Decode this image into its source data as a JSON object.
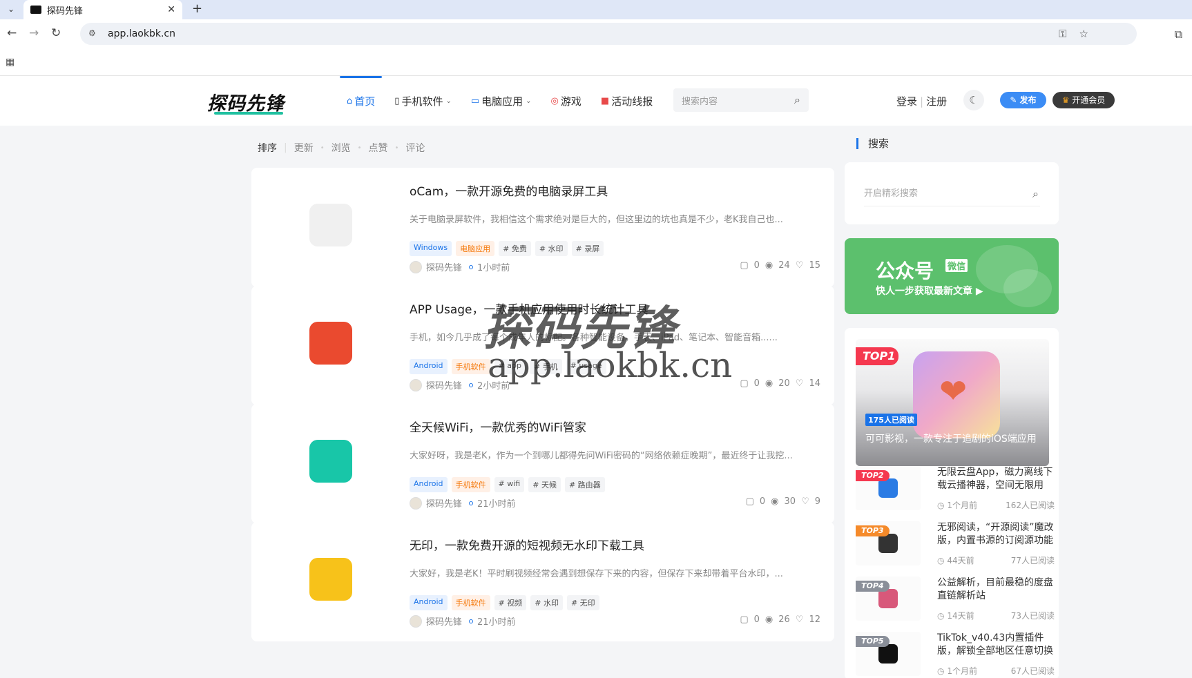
{
  "browser": {
    "tab_title": "探码先锋",
    "url": "app.laokbk.cn"
  },
  "header": {
    "logo": "探码先锋",
    "nav": [
      {
        "label": "首页",
        "icon": "home-icon",
        "active": true
      },
      {
        "label": "手机软件",
        "icon": "phone-icon",
        "dropdown": true
      },
      {
        "label": "电脑应用",
        "icon": "computer-icon",
        "dropdown": true
      },
      {
        "label": "游戏",
        "icon": "game-icon"
      },
      {
        "label": "活动线报",
        "icon": "flag-icon"
      }
    ],
    "search_placeholder": "搜索内容",
    "login": "登录",
    "register": "注册",
    "publish": "发布",
    "vip": "开通会员"
  },
  "sort": {
    "items": [
      "排序",
      "更新",
      "浏览",
      "点赞",
      "评论"
    ]
  },
  "posts": [
    {
      "title": "oCam，一款开源免费的电脑录屏工具",
      "excerpt": "关于电脑录屏软件，我相信这个需求绝对是巨大的，但这里边的坑也真是不少，老K我自己也...",
      "tags": [
        {
          "t": "Windows",
          "c": "blue"
        },
        {
          "t": "电脑应用",
          "c": "orange"
        },
        {
          "t": "# 免费",
          "c": ""
        },
        {
          "t": "# 水印",
          "c": ""
        },
        {
          "t": "# 录屏",
          "c": ""
        }
      ],
      "author": "探码先锋",
      "time": "1小时前",
      "comments": "0",
      "views": "24",
      "likes": "15",
      "icon_color": "#f0f0f0"
    },
    {
      "title": "APP Usage，一款手机应用使用时长统计工具",
      "excerpt": "手机，如今几乎成了每个成年人的标配。各种智能设备，手表、iPad、笔记本、智能音箱......",
      "tags": [
        {
          "t": "Android",
          "c": "blue"
        },
        {
          "t": "手机软件",
          "c": "orange"
        },
        {
          "t": "# app",
          "c": ""
        },
        {
          "t": "# 手机",
          "c": ""
        },
        {
          "t": "# usage",
          "c": ""
        }
      ],
      "author": "探码先锋",
      "time": "2小时前",
      "comments": "0",
      "views": "20",
      "likes": "14",
      "icon_color": "#ea4a2f"
    },
    {
      "title": "全天候WiFi，一款优秀的WiFi管家",
      "excerpt": "大家好呀，我是老K，作为一个到哪儿都得先问WiFi密码的“网络依赖症晚期”，最近终于让我挖...",
      "tags": [
        {
          "t": "Android",
          "c": "blue"
        },
        {
          "t": "手机软件",
          "c": "orange"
        },
        {
          "t": "# wifi",
          "c": ""
        },
        {
          "t": "# 天候",
          "c": ""
        },
        {
          "t": "# 路由器",
          "c": ""
        }
      ],
      "author": "探码先锋",
      "time": "21小时前",
      "comments": "0",
      "views": "30",
      "likes": "9",
      "icon_color": "#18c6a8"
    },
    {
      "title": "无印，一款免费开源的短视频无水印下载工具",
      "excerpt": "大家好，我是老K！平时刷视频经常会遇到想保存下来的内容，但保存下来却带着平台水印，...",
      "tags": [
        {
          "t": "Android",
          "c": "blue"
        },
        {
          "t": "手机软件",
          "c": "orange"
        },
        {
          "t": "# 视频",
          "c": ""
        },
        {
          "t": "# 水印",
          "c": ""
        },
        {
          "t": "# 无印",
          "c": ""
        }
      ],
      "author": "探码先锋",
      "time": "21小时前",
      "comments": "0",
      "views": "26",
      "likes": "12",
      "icon_color": "#f7c21a"
    }
  ],
  "sidebar": {
    "search_title": "搜索",
    "search_placeholder": "开启精彩搜索",
    "gzh_title": "公众号",
    "gzh_tag": "微信",
    "gzh_sub": "快人一步获取最新文章 ▶",
    "top1": {
      "rank": "TOP1",
      "reads": "175人已阅读",
      "title": "可可影视，一款专注于追剧的iOS端应用"
    },
    "top": [
      {
        "rank": "TOP2",
        "title": "无限云盘App，磁力离线下载云播神器，空间无限用",
        "time": "1个月前",
        "reads": "162人已阅读",
        "rank_color": "#f5384f",
        "icon_color": "#2a7be4"
      },
      {
        "rank": "TOP3",
        "title": "无邪阅读，“开源阅读”魔改版，内置书源的订阅源功能",
        "time": "44天前",
        "reads": "77人已阅读",
        "rank_color": "#f58a2a",
        "icon_color": "#333333"
      },
      {
        "rank": "TOP4",
        "title": "公益解析，目前最稳的度盘直链解析站",
        "time": "14天前",
        "reads": "73人已阅读",
        "rank_color": "#8a8f99",
        "icon_color": "#d8587a"
      },
      {
        "rank": "TOP5",
        "title": "TikTok_v40.43内置插件版，解锁全部地区任意切换",
        "time": "1个月前",
        "reads": "67人已阅读",
        "rank_color": "#8a8f99",
        "icon_color": "#111111"
      }
    ]
  },
  "watermark": {
    "line1": "探码先锋",
    "line2": "app.laokbk.cn"
  }
}
